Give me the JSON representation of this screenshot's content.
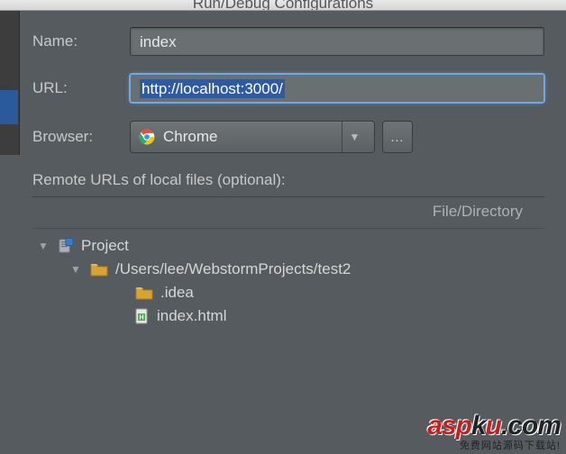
{
  "window": {
    "title": "Run/Debug Configurations"
  },
  "form": {
    "name_label": "Name:",
    "name_value": "index",
    "url_label": "URL:",
    "url_value": "http://localhost:3000/",
    "browser_label": "Browser:",
    "browser_value": "Chrome",
    "more_btn": "...",
    "remote_urls_title": "Remote URLs of local files (optional):",
    "column_header": "File/Directory"
  },
  "tree": {
    "root": "Project",
    "path": "/Users/lee/WebstormProjects/test2",
    "idea": ".idea",
    "index": "index.html"
  },
  "watermark": {
    "red1": "asp",
    "red2": "u",
    "dark1": "k",
    "dark2": ".com",
    "tagline": "免费网站源码下载站!"
  }
}
